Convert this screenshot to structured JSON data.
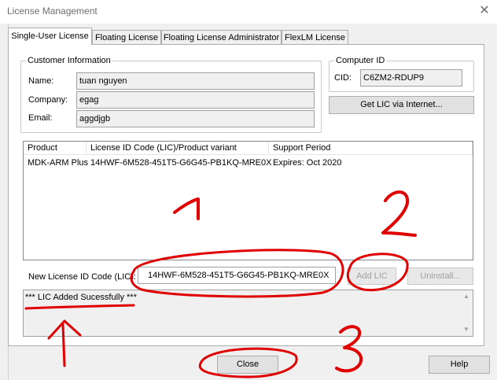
{
  "window": {
    "title": "License Management",
    "close_glyph": "✕"
  },
  "tabs": [
    {
      "label": "Single-User License",
      "active": true
    },
    {
      "label": "Floating License",
      "active": false
    },
    {
      "label": "Floating License Administrator",
      "active": false
    },
    {
      "label": "FlexLM License",
      "active": false
    }
  ],
  "customer": {
    "group_title": "Customer Information",
    "name_label": "Name:",
    "name_value": "tuan nguyen",
    "company_label": "Company:",
    "company_value": "egag",
    "email_label": "Email:",
    "email_value": "aggdjgb"
  },
  "computer": {
    "group_title": "Computer ID",
    "cid_label": "CID:",
    "cid_value": "C6ZM2-RDUP9",
    "get_lic_button": "Get LIC via Internet..."
  },
  "license_table": {
    "columns": [
      "Product",
      "License ID Code (LIC)/Product variant",
      "Support Period"
    ],
    "rows": [
      {
        "product": "MDK-ARM Plus",
        "lic": "14HWF-6M528-451T5-G6G45-PB1KQ-MRE0X",
        "support": "Expires: Oct 2020"
      }
    ]
  },
  "new_lic": {
    "label": "New License ID Code (LIC):",
    "value": "14HWF-6M528-451T5-G6G45-PB1KQ-MRE0X",
    "add_button": "Add LIC",
    "uninstall_button": "Uninstall..."
  },
  "message": "*** LIC Added Sucessfully ***",
  "footer": {
    "close_button": "Close",
    "help_button": "Help"
  },
  "annotations": {
    "number_1": "1",
    "number_2": "2",
    "number_3": "3",
    "color": "#e00000"
  }
}
